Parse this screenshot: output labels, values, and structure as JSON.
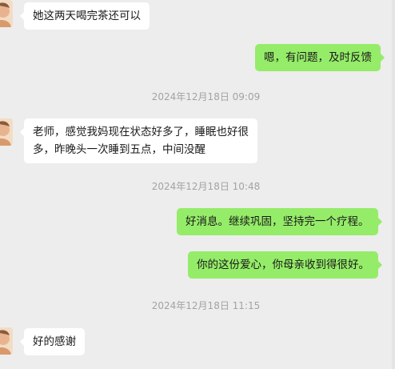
{
  "colors": {
    "background": "#ededed",
    "incoming_bubble": "#ffffff",
    "outgoing_bubble": "#95ec69",
    "timestamp_text": "#a3a3a3"
  },
  "messages": [
    {
      "direction": "in",
      "text": "她这两天喝完茶还可以"
    },
    {
      "direction": "out",
      "text": "嗯，有问题，及时反馈"
    },
    {
      "type": "timestamp",
      "text": "2024年12月18日 09:09"
    },
    {
      "direction": "in",
      "lines": [
        "老师，感觉我妈现在状态好多了，睡眠也好很",
        "多，昨晚头一次睡到五点，中间没醒"
      ]
    },
    {
      "type": "timestamp",
      "text": "2024年12月18日 10:48"
    },
    {
      "direction": "out",
      "text": "好消息。继续巩固，坚持完一个疗程。"
    },
    {
      "direction": "out",
      "text": "你的这份爱心，你母亲收到得很好。"
    },
    {
      "type": "timestamp",
      "text": "2024年12月18日 11:15"
    },
    {
      "direction": "in",
      "text": "好的感谢"
    }
  ],
  "avatar_icon": "contact-avatar-icon"
}
